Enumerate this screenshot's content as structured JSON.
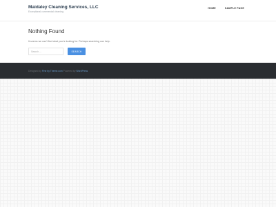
{
  "header": {
    "site_title": "Maidaley Cleaning Services, LLC",
    "tagline": "Exceptional commercial cleaning",
    "nav": [
      {
        "label": "HOME"
      },
      {
        "label": "SAMPLE PAGE"
      }
    ]
  },
  "main": {
    "title": "Nothing Found",
    "message": "It seems we can't find what you're looking for. Perhaps searching can help.",
    "search": {
      "placeholder": "Search ...",
      "button_label": "SEARCH"
    }
  },
  "footer": {
    "prefix": "Designed by",
    "theme_link": "Fine by Theme.com",
    "middle": "Powered by",
    "wp_link": "WordPress"
  },
  "colors": {
    "accent": "#4a90e2",
    "footer_bg": "#2a2d31",
    "title": "#2c3e50"
  }
}
